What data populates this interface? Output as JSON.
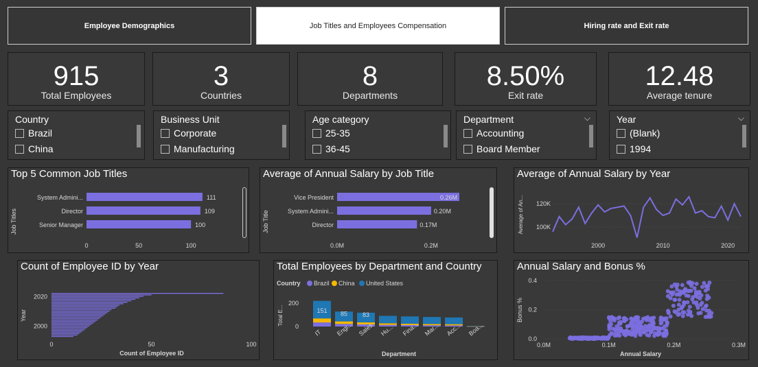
{
  "tabs": [
    {
      "label": "Employee Demographics",
      "active": false
    },
    {
      "label": "Job Titles and Employees Compensation",
      "active": true
    },
    {
      "label": "Hiring rate and Exit rate",
      "active": false
    }
  ],
  "kpis": [
    {
      "value": "915",
      "label": "Total Employees"
    },
    {
      "value": "3",
      "label": "Countries"
    },
    {
      "value": "8",
      "label": "Departments"
    },
    {
      "value": "8.50%",
      "label": "Exit rate"
    },
    {
      "value": "12.48",
      "label": "Average tenure"
    }
  ],
  "slicers": [
    {
      "title": "Country",
      "options": [
        "Brazil",
        "China"
      ],
      "dropdown": false
    },
    {
      "title": "Business Unit",
      "options": [
        "Corporate",
        "Manufacturing"
      ],
      "dropdown": false
    },
    {
      "title": "Age category",
      "options": [
        "25-35",
        "36-45"
      ],
      "dropdown": false
    },
    {
      "title": "Department",
      "options": [
        "Accounting",
        "Board Member"
      ],
      "dropdown": true
    },
    {
      "title": "Year",
      "options": [
        "(Blank)",
        "1994"
      ],
      "dropdown": true
    }
  ],
  "panels": {
    "top_jobs": {
      "title": "Top 5 Common Job Titles",
      "ylabel": "Job Titles"
    },
    "avg_salary_title": {
      "title": "Average of Annual Salary by Job Title",
      "ylabel": "Job Title"
    },
    "avg_salary_year": {
      "title": "Average of Annual Salary by Year",
      "ylabel": "Average of An..."
    },
    "count_year": {
      "title": "Count of Employee ID by Year",
      "xlabel": "Count of Employee ID",
      "ylabel": "Year"
    },
    "dept_country": {
      "title": "Total Employees by Department and Country",
      "legend_title": "Country",
      "xlabel": "Department",
      "ylabel": "Total E..."
    },
    "scatter": {
      "title": "Annual Salary and Bonus %",
      "xlabel": "Annual Salary",
      "ylabel": "Bonus %"
    }
  },
  "colors": {
    "accent": "#7b6fe0",
    "brazil": "#7b6fe0",
    "china": "#f5b800",
    "us": "#1f77b4"
  },
  "chart_data": [
    {
      "type": "bar",
      "title": "Top 5 Common Job Titles",
      "ylabel": "Job Titles",
      "categories": [
        "System Admini...",
        "Director",
        "Senior Manager"
      ],
      "values": [
        111,
        109,
        100
      ],
      "data_labels": [
        "111",
        "109",
        "100"
      ],
      "xticks": [
        "0",
        "50",
        "100"
      ],
      "xlim": [
        0,
        115
      ]
    },
    {
      "type": "bar",
      "title": "Average of Annual Salary by Job Title",
      "ylabel": "Job Title",
      "categories": [
        "Vice President",
        "System Admini...",
        "Director"
      ],
      "values": [
        0.26,
        0.2,
        0.17
      ],
      "data_labels": [
        "0.26M",
        "0.20M",
        "0.17M"
      ],
      "xticks": [
        "0.0M",
        "0.2M"
      ],
      "xlim": [
        0,
        0.26
      ]
    },
    {
      "type": "line",
      "title": "Average of Annual Salary by Year",
      "ylabel": "Average of An...",
      "x": [
        1993,
        1994,
        1995,
        1996,
        1997,
        1998,
        1999,
        2000,
        2001,
        2002,
        2003,
        2004,
        2005,
        2006,
        2007,
        2008,
        2009,
        2010,
        2011,
        2012,
        2013,
        2014,
        2015,
        2016,
        2017,
        2018,
        2019,
        2020,
        2021
      ],
      "values": [
        96,
        109,
        102,
        107,
        117,
        103,
        112,
        119,
        113,
        116,
        117,
        118,
        110,
        91,
        117,
        125,
        115,
        110,
        112,
        124,
        119,
        126,
        112,
        114,
        109,
        108,
        118,
        106,
        120,
        109
      ],
      "xticks": [
        "2000",
        "2010",
        "2020"
      ],
      "yticks": [
        "100K",
        "120K"
      ],
      "ylim": [
        90,
        130
      ]
    },
    {
      "type": "bar",
      "title": "Count of Employee ID by Year",
      "xlabel": "Count of Employee ID",
      "ylabel": "Year",
      "y": [
        2022,
        2021,
        2020,
        2019,
        2018,
        2017,
        2016,
        2015,
        2014,
        2013,
        2012,
        2011,
        2010,
        2009,
        2008,
        2007,
        2006,
        2005,
        2004,
        2003,
        2002,
        2001,
        2000,
        1999,
        1998,
        1997,
        1996,
        1995,
        1994,
        1993
      ],
      "values": [
        86,
        50,
        46,
        44,
        42,
        40,
        38,
        36,
        34,
        33,
        32,
        30,
        29,
        28,
        27,
        26,
        25,
        24,
        23,
        22,
        21,
        20,
        19,
        18,
        17,
        16,
        15,
        14,
        13,
        11
      ],
      "xticks": [
        "0",
        "50",
        "100"
      ],
      "yticks": [
        "2020",
        "2000"
      ],
      "xlim": [
        0,
        100
      ]
    },
    {
      "type": "bar",
      "title": "Total Employees by Department and Country",
      "legend": [
        "Brazil",
        "China",
        "United States"
      ],
      "categories": [
        "IT",
        "Engi...",
        "Sales",
        "Hu...",
        "Fina...",
        "Mar...",
        "Acc...",
        "Boa..."
      ],
      "series": [
        {
          "name": "Brazil",
          "values": [
            35,
            22,
            18,
            14,
            12,
            11,
            10,
            1
          ]
        },
        {
          "name": "China",
          "values": [
            35,
            22,
            18,
            14,
            12,
            11,
            10,
            1
          ]
        },
        {
          "name": "United States",
          "values": [
            151,
            85,
            83,
            64,
            63,
            60,
            58,
            3
          ]
        }
      ],
      "data_labels": [
        "151",
        "85",
        "83"
      ],
      "yticks": [
        "0",
        "200"
      ],
      "ylim": [
        0,
        260
      ]
    },
    {
      "type": "scatter",
      "title": "Annual Salary and Bonus %",
      "xlabel": "Annual Salary",
      "ylabel": "Bonus %",
      "xticks": [
        "0.0M",
        "0.1M",
        "0.2M",
        "0.3M"
      ],
      "yticks": [
        "0.0",
        "0.2",
        "0.4"
      ],
      "xlim": [
        0,
        0.3
      ],
      "ylim": [
        0,
        0.4
      ]
    }
  ]
}
